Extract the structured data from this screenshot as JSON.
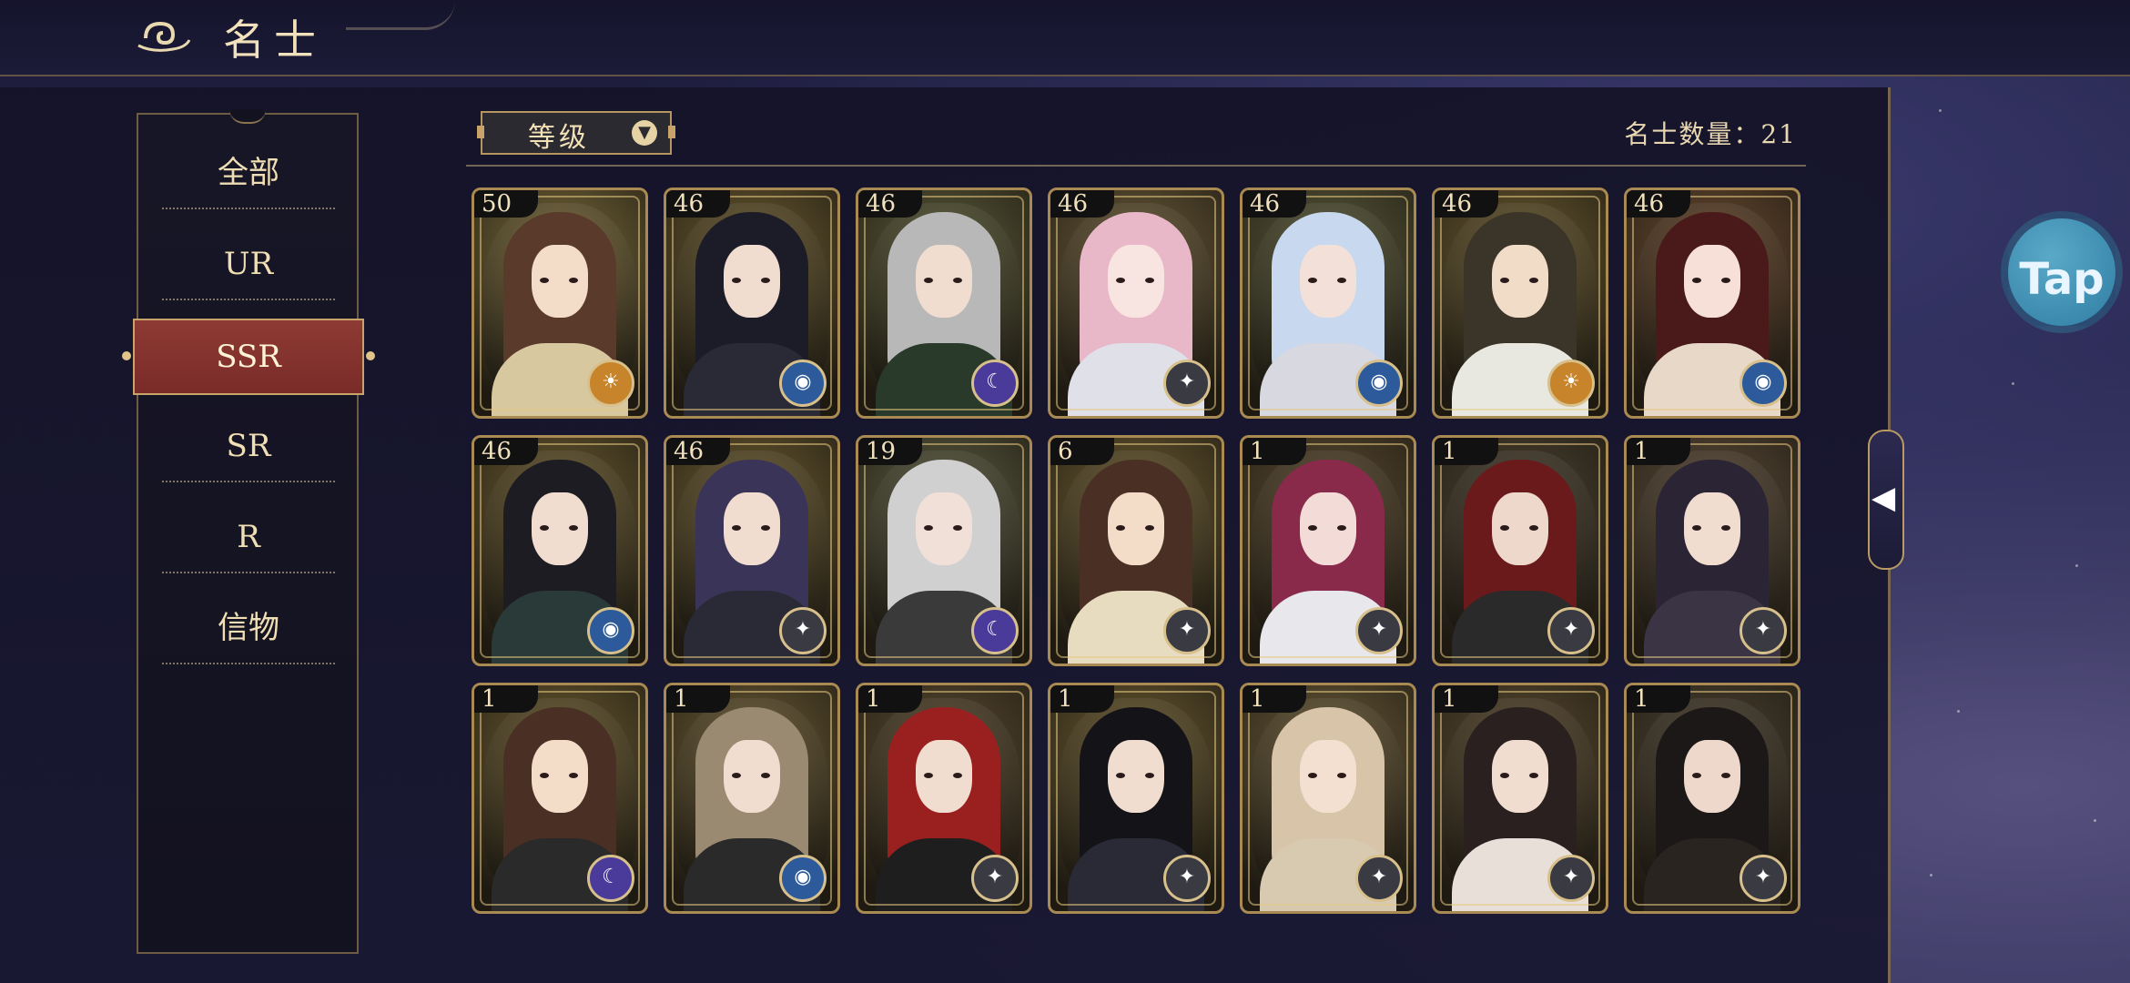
{
  "header": {
    "title": "名士"
  },
  "sidebar": {
    "items": [
      {
        "label": "全部",
        "active": false
      },
      {
        "label": "UR",
        "active": false
      },
      {
        "label": "SSR",
        "active": true
      },
      {
        "label": "SR",
        "active": false
      },
      {
        "label": "R",
        "active": false
      },
      {
        "label": "信物",
        "active": false
      }
    ]
  },
  "toolbar": {
    "sort_label": "等级",
    "count_text": "名士数量：21"
  },
  "tap_button": {
    "label": "Tap"
  },
  "cards": [
    {
      "level": "50",
      "badge_icon": "sun-medallion-icon",
      "palette": {
        "bg": "#7a6a3a",
        "hair": "#5a3a2a",
        "robe": "#d8c8a0",
        "face": "#f3dcc8",
        "badge": "#c8842a"
      }
    },
    {
      "level": "46",
      "badge_icon": "eye-medallion-icon",
      "palette": {
        "bg": "#6a5a30",
        "hair": "#1c1c28",
        "robe": "#2a2a36",
        "face": "#f1dcd0",
        "badge": "#2c5a9a"
      }
    },
    {
      "level": "46",
      "badge_icon": "moon-medallion-icon",
      "palette": {
        "bg": "#5a5a38",
        "hair": "#b8b8b8",
        "robe": "#2a3a2a",
        "face": "#f1dcd0",
        "badge": "#4a3a9a"
      }
    },
    {
      "level": "46",
      "badge_icon": "compass-icon",
      "palette": {
        "bg": "#6a5a38",
        "hair": "#e8b8c8",
        "robe": "#e0e0e8",
        "face": "#f8e4e0",
        "badge": "#3a3a42"
      }
    },
    {
      "level": "46",
      "badge_icon": "eye-medallion-icon",
      "palette": {
        "bg": "#5a5a3a",
        "hair": "#c8d8ee",
        "robe": "#d8d8e0",
        "face": "#f3e0d8",
        "badge": "#2c5a9a"
      }
    },
    {
      "level": "46",
      "badge_icon": "sun-medallion-icon",
      "palette": {
        "bg": "#6a5a30",
        "hair": "#3a3528",
        "robe": "#e8e8e0",
        "face": "#f1dcc8",
        "badge": "#c8842a"
      }
    },
    {
      "level": "46",
      "badge_icon": "eye-medallion-icon",
      "palette": {
        "bg": "#6a4a30",
        "hair": "#4a1a1a",
        "robe": "#e8d8c8",
        "face": "#f6e0d8",
        "badge": "#2c5a9a"
      }
    },
    {
      "level": "46",
      "badge_icon": "eye-medallion-icon",
      "palette": {
        "bg": "#6a5a30",
        "hair": "#1c1c22",
        "robe": "#2a3a38",
        "face": "#f1dcd0",
        "badge": "#2c5a9a"
      }
    },
    {
      "level": "46",
      "badge_icon": "compass-icon",
      "palette": {
        "bg": "#6a5a30",
        "hair": "#3a3458",
        "robe": "#2a2a36",
        "face": "#f1dcd0",
        "badge": "#3a3a42"
      }
    },
    {
      "level": "19",
      "badge_icon": "moon-medallion-icon",
      "palette": {
        "bg": "#5a5a40",
        "hair": "#d0d0d0",
        "robe": "#3a3a3a",
        "face": "#f1e0d8",
        "badge": "#4a3a9a"
      }
    },
    {
      "level": "6",
      "badge_icon": "compass-icon",
      "palette": {
        "bg": "#6a5a30",
        "hair": "#4a3024",
        "robe": "#e8dcc0",
        "face": "#f3dcc8",
        "badge": "#3a3a42"
      }
    },
    {
      "level": "1",
      "badge_icon": "compass-icon",
      "palette": {
        "bg": "#5a4a30",
        "hair": "#8a2a4a",
        "robe": "#e8e8ec",
        "face": "#f3dcd8",
        "badge": "#3a3a42"
      }
    },
    {
      "level": "1",
      "badge_icon": "compass-icon",
      "palette": {
        "bg": "#4a4030",
        "hair": "#6a1a1a",
        "robe": "#2a2a2a",
        "face": "#eed8cc",
        "badge": "#3a3a42"
      }
    },
    {
      "level": "1",
      "badge_icon": "compass-icon",
      "palette": {
        "bg": "#5a4a38",
        "hair": "#2a2434",
        "robe": "#3a3444",
        "face": "#f1dcd0",
        "badge": "#3a3a42"
      }
    },
    {
      "level": "1",
      "badge_icon": "moon-medallion-icon",
      "palette": {
        "bg": "#6a5a30",
        "hair": "#4a3024",
        "robe": "#2a2a2a",
        "face": "#f3dcc8",
        "badge": "#4a3a9a"
      }
    },
    {
      "level": "1",
      "badge_icon": "eye-medallion-icon",
      "palette": {
        "bg": "#6a5a34",
        "hair": "#9a8a72",
        "robe": "#2a2a2a",
        "face": "#f1dcd0",
        "badge": "#2c5a9a"
      }
    },
    {
      "level": "1",
      "badge_icon": "compass-icon",
      "palette": {
        "bg": "#5a4a30",
        "hair": "#9a2020",
        "robe": "#1e1e1e",
        "face": "#f1dcd0",
        "badge": "#3a3a42"
      }
    },
    {
      "level": "1",
      "badge_icon": "compass-icon",
      "palette": {
        "bg": "#6a5a30",
        "hair": "#141418",
        "robe": "#2a2a36",
        "face": "#f1dcd0",
        "badge": "#3a3a42"
      }
    },
    {
      "level": "1",
      "badge_icon": "compass-icon",
      "palette": {
        "bg": "#6a5a38",
        "hair": "#d8c4a8",
        "robe": "#d8cab0",
        "face": "#f3e0d0",
        "badge": "#3a3a42"
      }
    },
    {
      "level": "1",
      "badge_icon": "compass-icon",
      "palette": {
        "bg": "#5a4a30",
        "hair": "#2a2020",
        "robe": "#e8e0d8",
        "face": "#f1dcd0",
        "badge": "#3a3a42"
      }
    },
    {
      "level": "1",
      "badge_icon": "compass-icon",
      "palette": {
        "bg": "#4a4030",
        "hair": "#1c1818",
        "robe": "#2a2420",
        "face": "#eed8cc",
        "badge": "#3a3a42"
      }
    }
  ]
}
